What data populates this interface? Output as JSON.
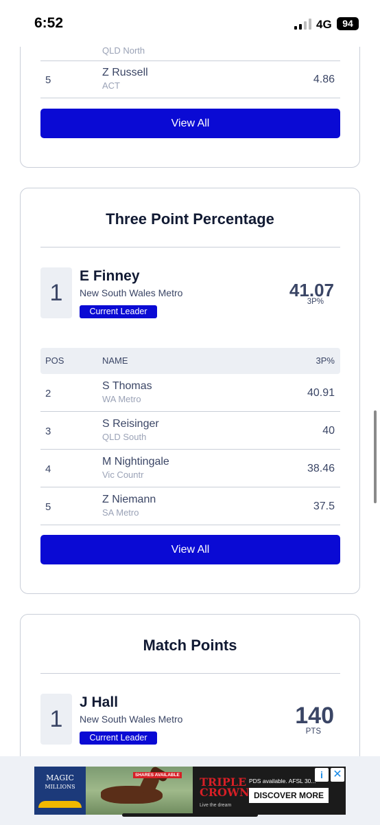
{
  "status_bar": {
    "time": "6:52",
    "network": "4G",
    "battery": "94"
  },
  "top_card": {
    "cut_team": "QLD North",
    "rows": [
      {
        "pos": "5",
        "name": "Z Russell",
        "team": "ACT",
        "value": "4.86"
      }
    ],
    "view_all": "View All"
  },
  "three_point_card": {
    "title": "Three Point Percentage",
    "leader": {
      "rank": "1",
      "name": "E Finney",
      "team": "New South Wales Metro",
      "badge": "Current Leader",
      "value": "41.07",
      "unit": "3P%"
    },
    "headers": {
      "pos": "POS",
      "name": "NAME",
      "value": "3P%"
    },
    "rows": [
      {
        "pos": "2",
        "name": "S Thomas",
        "team": "WA Metro",
        "value": "40.91"
      },
      {
        "pos": "3",
        "name": "S Reisinger",
        "team": "QLD South",
        "value": "40"
      },
      {
        "pos": "4",
        "name": "M Nightingale",
        "team": "Vic Countr",
        "value": "38.46"
      },
      {
        "pos": "5",
        "name": "Z Niemann",
        "team": "SA Metro",
        "value": "37.5"
      }
    ],
    "view_all": "View All"
  },
  "match_points_card": {
    "title": "Match Points",
    "leader": {
      "rank": "1",
      "name": "J Hall",
      "team": "New South Wales Metro",
      "badge": "Current Leader",
      "value": "140",
      "unit": "PTS"
    }
  },
  "ad": {
    "brand_line1": "MAGIC",
    "brand_line2": "MILLIONS",
    "shares_tag": "SHARES AVAILABLE",
    "tc_line1": "TRIPLE",
    "tc_line2": "CROWN",
    "tc_sub": "Live the dream",
    "text": "PDS available. AFSL 30...",
    "cta": "DISCOVER MORE",
    "info_icon": "info-icon",
    "close_icon": "close-icon"
  },
  "colors": {
    "primary_button": "#0a0ad4",
    "text_dark": "#111a33",
    "text_muted": "#3a4565",
    "border": "#c9ced8",
    "header_bg": "#eceff4"
  }
}
